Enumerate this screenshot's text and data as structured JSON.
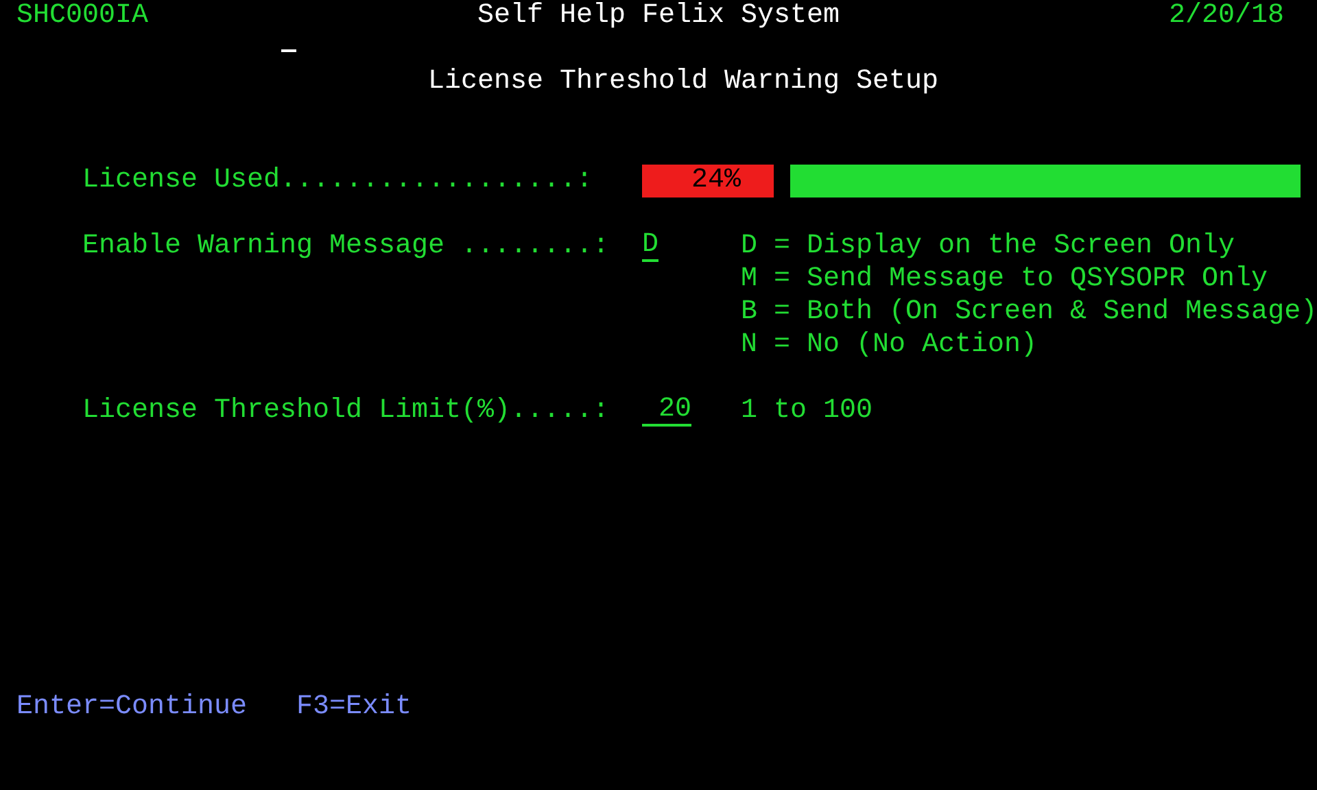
{
  "header": {
    "program_id": "SHC000IA",
    "title": "Self Help Felix System",
    "date": "2/20/18"
  },
  "subtitle": "License Threshold Warning Setup",
  "fields": [
    {
      "kind": "meter",
      "label": "License Used..................:",
      "reading": "24%",
      "level": 0.2
    },
    {
      "kind": "choice",
      "label": "Enable Warning Message ........:",
      "value": "D",
      "options": [
        "D = Display on the Screen Only",
        "M = Send Message to QSYSOPR Only",
        "B = Both (On Screen & Send Message)",
        "N = No (No Action)"
      ]
    },
    {
      "kind": "number",
      "label": "License Threshold Limit(%).....:",
      "value": "20",
      "hint": "1 to 100"
    }
  ],
  "function_keys": [
    "Enter=Continue",
    "F3=Exit"
  ]
}
